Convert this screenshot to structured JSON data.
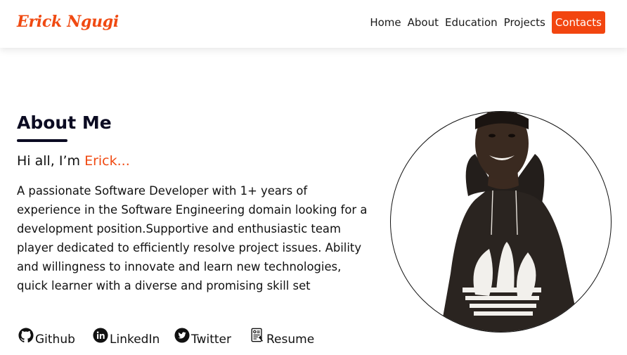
{
  "brand": {
    "logo_text": "Erick Ngugi",
    "accent": "#f04a12"
  },
  "nav": {
    "items": [
      {
        "label": "Home"
      },
      {
        "label": "About"
      },
      {
        "label": "Education"
      },
      {
        "label": "Projects"
      }
    ],
    "contact_label": "Contacts"
  },
  "about": {
    "title": "About Me",
    "greeting_prefix": "Hi all, I’m ",
    "greeting_name": "Erick...",
    "bio": "A passionate Software Developer with 1+ years of experience in the Software Engineering domain looking for a development position.Supportive and enthusiastic team player dedicated to efficiently resolve project issues. Ability and willingness to innovate and learn new technologies, quick learner with a diverse and promising skill set"
  },
  "social": {
    "items": [
      {
        "label": "Github",
        "icon": "github-icon"
      },
      {
        "label": "LinkedIn",
        "icon": "linkedin-icon"
      },
      {
        "label": "Twitter",
        "icon": "twitter-icon"
      },
      {
        "label": "Resume",
        "icon": "resume-icon"
      }
    ]
  },
  "portrait": {
    "icon": "profile-photo"
  }
}
